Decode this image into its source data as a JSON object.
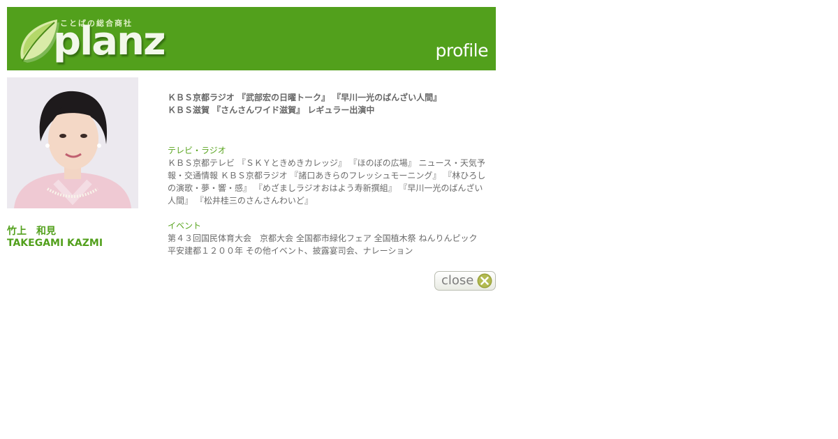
{
  "header": {
    "logo_text": "planz",
    "logo_tagline": "ことばの総合商社",
    "section_label": "profile",
    "background_color": "#52a01c"
  },
  "person": {
    "name_jp": "竹上　和見",
    "name_en": "TAKEGAMI KAZMI"
  },
  "highlight_lines": [
    "ＫＢＳ京都ラジオ 『武部宏の日曜トーク』 『早川一光のばんざい人間』",
    "ＫＢＳ滋賀 『さんさんワイド滋賀』 レギュラー出演中"
  ],
  "sections": [
    {
      "title": "テレビ・ラジオ",
      "lines": [
        "ＫＢＳ京都テレビ 『ＳＫＹときめきカレッジ』 『ほのぼの広場』 ニュース・天気予",
        "報・交通情報 ＫＢＳ京都ラジオ 『諸口あきらのフレッシュモーニング』 『林ひろし",
        "の演歌・夢・響・感』 『めざましラジオおはよう寿新撰組』 『早川一光のばんざい",
        "人間』 『松井桂三のさんさんわいど』"
      ]
    },
    {
      "title": "イベント",
      "lines": [
        "第４３回国民体育大会　京都大会 全国都市緑化フェア 全国植木祭 ねんりんピック",
        "平安建都１２００年 その他イベント、披露宴司会、ナレーション"
      ]
    }
  ],
  "close_button": {
    "label": "close",
    "icon": "close-x-icon"
  },
  "colors": {
    "accent_green": "#52a01c",
    "text_gray": "#666666"
  }
}
